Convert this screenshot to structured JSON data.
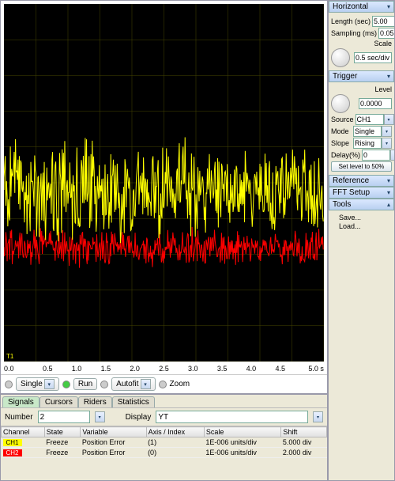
{
  "chart_data": {
    "type": "line",
    "title": "",
    "xlabel": "s",
    "ylabel": "",
    "xlim": [
      0,
      5
    ],
    "x_ticks": [
      "0.0",
      "0.5",
      "1.0",
      "1.5",
      "2.0",
      "2.5",
      "3.0",
      "3.5",
      "4.0",
      "4.5",
      "5.0 s"
    ],
    "plot_annotation": "T1",
    "grid_divisions": {
      "x": 10,
      "y": 10
    },
    "series": [
      {
        "name": "CH1",
        "color": "#ffff00",
        "baseline_div": 5.2,
        "amplitude_div": 1.6,
        "scale": "1E-006 units/div",
        "shift": "5.000 div"
      },
      {
        "name": "CH2",
        "color": "#ff0000",
        "baseline_div": 6.8,
        "amplitude_div": 0.6,
        "scale": "1E-006 units/div",
        "shift": "2.000 div"
      }
    ]
  },
  "toolbar": {
    "single": "Single",
    "run": "Run",
    "autofit": "Autofit",
    "zoom": "Zoom"
  },
  "panels": {
    "horizontal": {
      "title": "Horizontal",
      "length_label": "Length (sec)",
      "length_value": "5.00",
      "sampling_label": "Sampling (ms)",
      "sampling_value": "0.05",
      "scale_label": "Scale",
      "scale_value": "0.5 sec/div"
    },
    "trigger": {
      "title": "Trigger",
      "level_label": "Level",
      "level_value": "0.0000",
      "source_label": "Source",
      "source_value": "CH1",
      "mode_label": "Mode",
      "mode_value": "Single",
      "slope_label": "Slope",
      "slope_value": "Rising",
      "delay_label": "Delay(%)",
      "delay_value": "0",
      "set50": "Set level to 50%"
    },
    "reference": {
      "title": "Reference"
    },
    "fft": {
      "title": "FFT Setup"
    },
    "tools": {
      "title": "Tools",
      "save": "Save...",
      "load": "Load..."
    }
  },
  "bottom": {
    "tabs": [
      "Signals",
      "Cursors",
      "Riders",
      "Statistics"
    ],
    "active_tab": 0,
    "number_label": "Number",
    "number_value": "2",
    "display_label": "Display",
    "display_value": "YT",
    "columns": [
      "Channel",
      "State",
      "Variable",
      "Axis / Index",
      "Scale",
      "Shift"
    ],
    "rows": [
      {
        "channel": "CH1",
        "css": "ch1",
        "state": "Freeze",
        "variable": "Position Error",
        "axis": "(1)",
        "scale": "1E-006 units/div",
        "shift": "5.000 div"
      },
      {
        "channel": "CH2",
        "css": "ch2",
        "state": "Freeze",
        "variable": "Position Error",
        "axis": "(0)",
        "scale": "1E-006 units/div",
        "shift": "2.000 div"
      }
    ]
  }
}
